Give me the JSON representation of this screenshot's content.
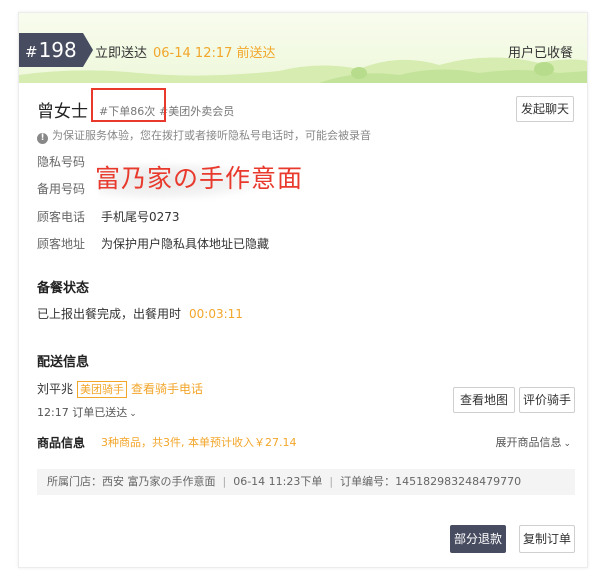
{
  "header": {
    "order_no": "198",
    "hash": "#",
    "delivery_label": "立即送达",
    "delivery_time": "06-14 12:17 前送达",
    "receipt_status": "用户已收餐"
  },
  "customer": {
    "name": "曾女士",
    "order_count_tag": "#下单86次",
    "member_tag": "#美团外卖会员",
    "chat_button": "发起聊天",
    "notice": "为保证服务体验，您在拨打或者接听隐私号电话时，可能会被录音",
    "notice_icon": "info-icon",
    "privacy_label": "隐私号码",
    "backup_label": "备用号码",
    "phone_label": "顾客电话",
    "phone_value": "手机尾号0273",
    "address_label": "顾客地址",
    "address_value": "为保护用户隐私具体地址已隐藏",
    "watermark": "富乃家の手作意面"
  },
  "prep": {
    "title": "备餐状态",
    "text": "已上报出餐完成，出餐用时",
    "duration": "00:03:11"
  },
  "delivery": {
    "title": "配送信息",
    "rider_name": "刘平兆",
    "rider_badge": "美团骑手",
    "rider_phone_link": "查看骑手电话",
    "sent_time": "12:17 订单已送达",
    "map_button": "查看地图",
    "rate_button": "评价骑手"
  },
  "goods": {
    "title": "商品信息",
    "summary": "3种商品，共3件, 本单预计收入￥27.14",
    "expand": "展开商品信息"
  },
  "info_bar": {
    "store": "所属门店：西安 富乃家の手作意面",
    "order_time": "06-14 11:23下单",
    "order_id": "订单编号：145182983248479770",
    "separator": "|"
  },
  "actions": {
    "refund": "部分退款",
    "copy": "复制订单"
  },
  "colors": {
    "accent_orange": "#f2a62a",
    "badge_dark": "#474c60",
    "annotation_red": "#e8392c",
    "banner_green": "#eef8db"
  }
}
